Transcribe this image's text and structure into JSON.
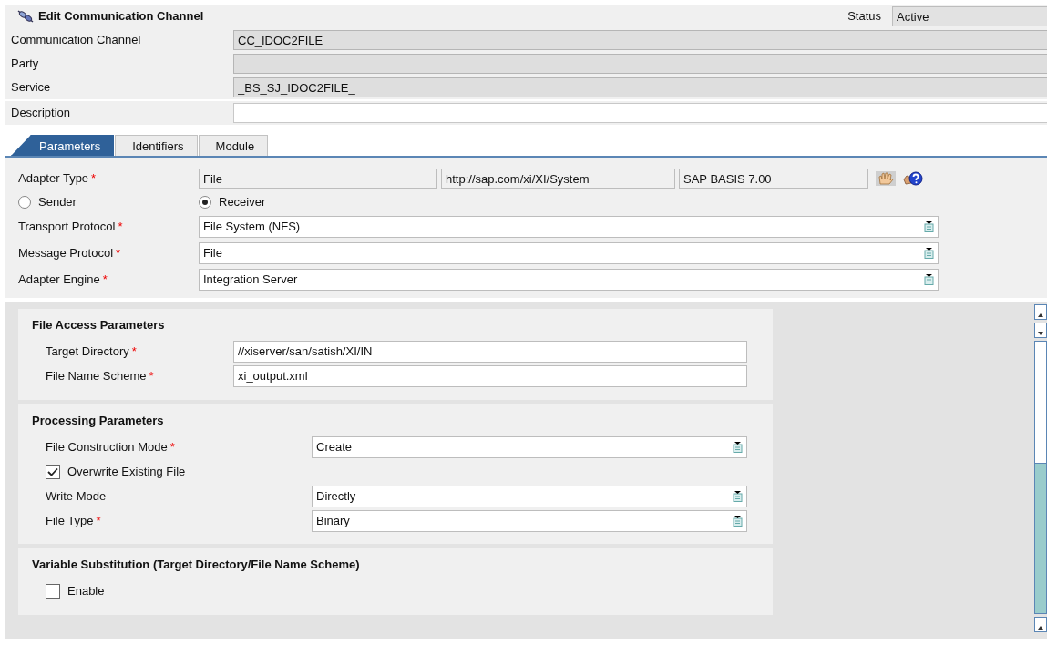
{
  "header": {
    "title": "Edit Communication Channel",
    "status_label": "Status",
    "status_value": "Active"
  },
  "fields": [
    {
      "label": "Communication Channel",
      "value": "CC_IDOC2FILE",
      "readonly": true
    },
    {
      "label": "Party",
      "readonly": true
    },
    {
      "label": "Service",
      "value": "_BS_SJ_IDOC2FILE_",
      "readonly": true
    },
    {
      "label": "Description",
      "readonly": false
    }
  ],
  "tabs": [
    {
      "label": "Parameters",
      "selected": true
    },
    {
      "label": "Identifiers",
      "selected": false
    },
    {
      "label": "Module",
      "selected": false
    }
  ],
  "adapter": {
    "label": "Adapter Type",
    "required_mark": "*",
    "values": [
      "File",
      "http://sap.com/xi/XI/System",
      "SAP BASIS 7.00"
    ]
  },
  "direction": [
    {
      "label": "Sender",
      "selected": false
    },
    {
      "label": "Receiver",
      "selected": true
    }
  ],
  "protocols": [
    {
      "label": "Transport Protocol",
      "required_mark": "*",
      "value": "File System (NFS)"
    },
    {
      "label": "Message Protocol",
      "required_mark": "*",
      "value": "File"
    },
    {
      "label": "Adapter Engine",
      "required_mark": "*",
      "value": "Integration Server"
    }
  ],
  "sections": [
    {
      "title": "File Access Parameters",
      "rows": [
        {
          "kind": "text",
          "label": "Target Directory",
          "required_mark": "*",
          "value": "//xiserver/san/satish/XI/IN"
        },
        {
          "kind": "text",
          "label": "File Name Scheme",
          "required_mark": "*",
          "value": "xi_output.xml"
        }
      ]
    },
    {
      "title": "Processing Parameters",
      "rows": [
        {
          "kind": "select",
          "label": "File Construction Mode",
          "required_mark": "*",
          "value": "Create"
        },
        {
          "kind": "checkbox",
          "label": "Overwrite Existing File",
          "checked": true
        },
        {
          "kind": "select",
          "label": "Write Mode",
          "value": "Directly"
        },
        {
          "kind": "select",
          "label": "File Type",
          "required_mark": "*",
          "value": "Binary"
        }
      ]
    },
    {
      "title": "Variable Substitution (Target Directory/File Name Scheme)",
      "rows": [
        {
          "kind": "checkbox",
          "label": "Enable",
          "checked": false
        }
      ]
    }
  ]
}
